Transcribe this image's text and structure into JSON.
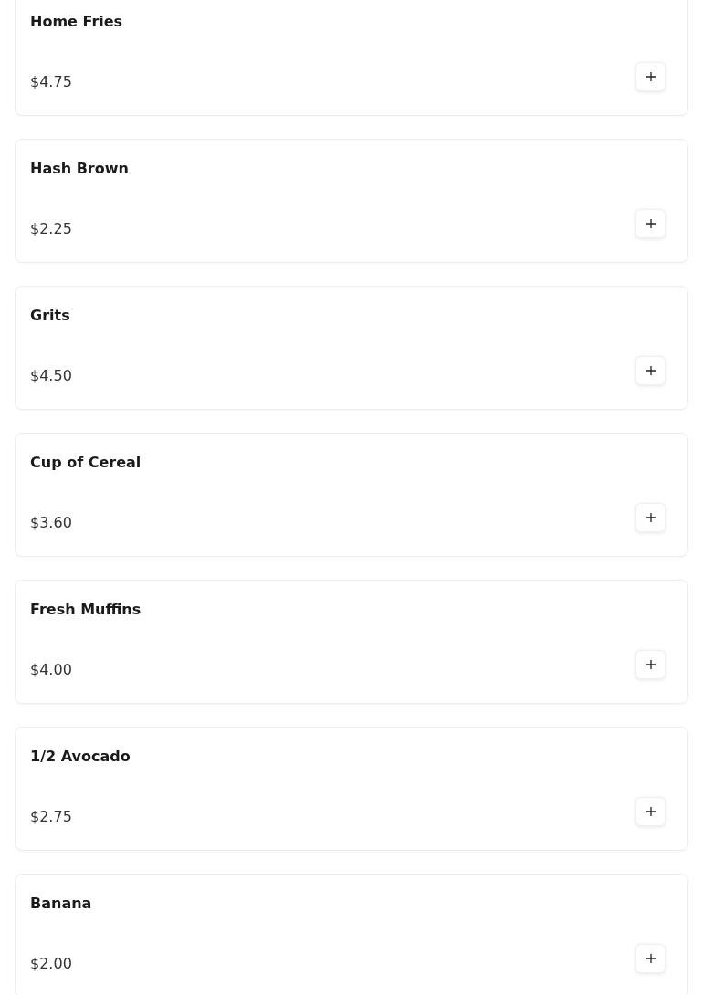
{
  "menu_items": [
    {
      "name": "Home Fries",
      "price": "$4.75"
    },
    {
      "name": "Hash Brown",
      "price": "$2.25"
    },
    {
      "name": "Grits",
      "price": "$4.50"
    },
    {
      "name": "Cup of Cereal",
      "price": "$3.60"
    },
    {
      "name": "Fresh Muffins",
      "price": "$4.00"
    },
    {
      "name": "1/2 Avocado",
      "price": "$2.75"
    },
    {
      "name": "Banana",
      "price": "$2.00"
    }
  ]
}
